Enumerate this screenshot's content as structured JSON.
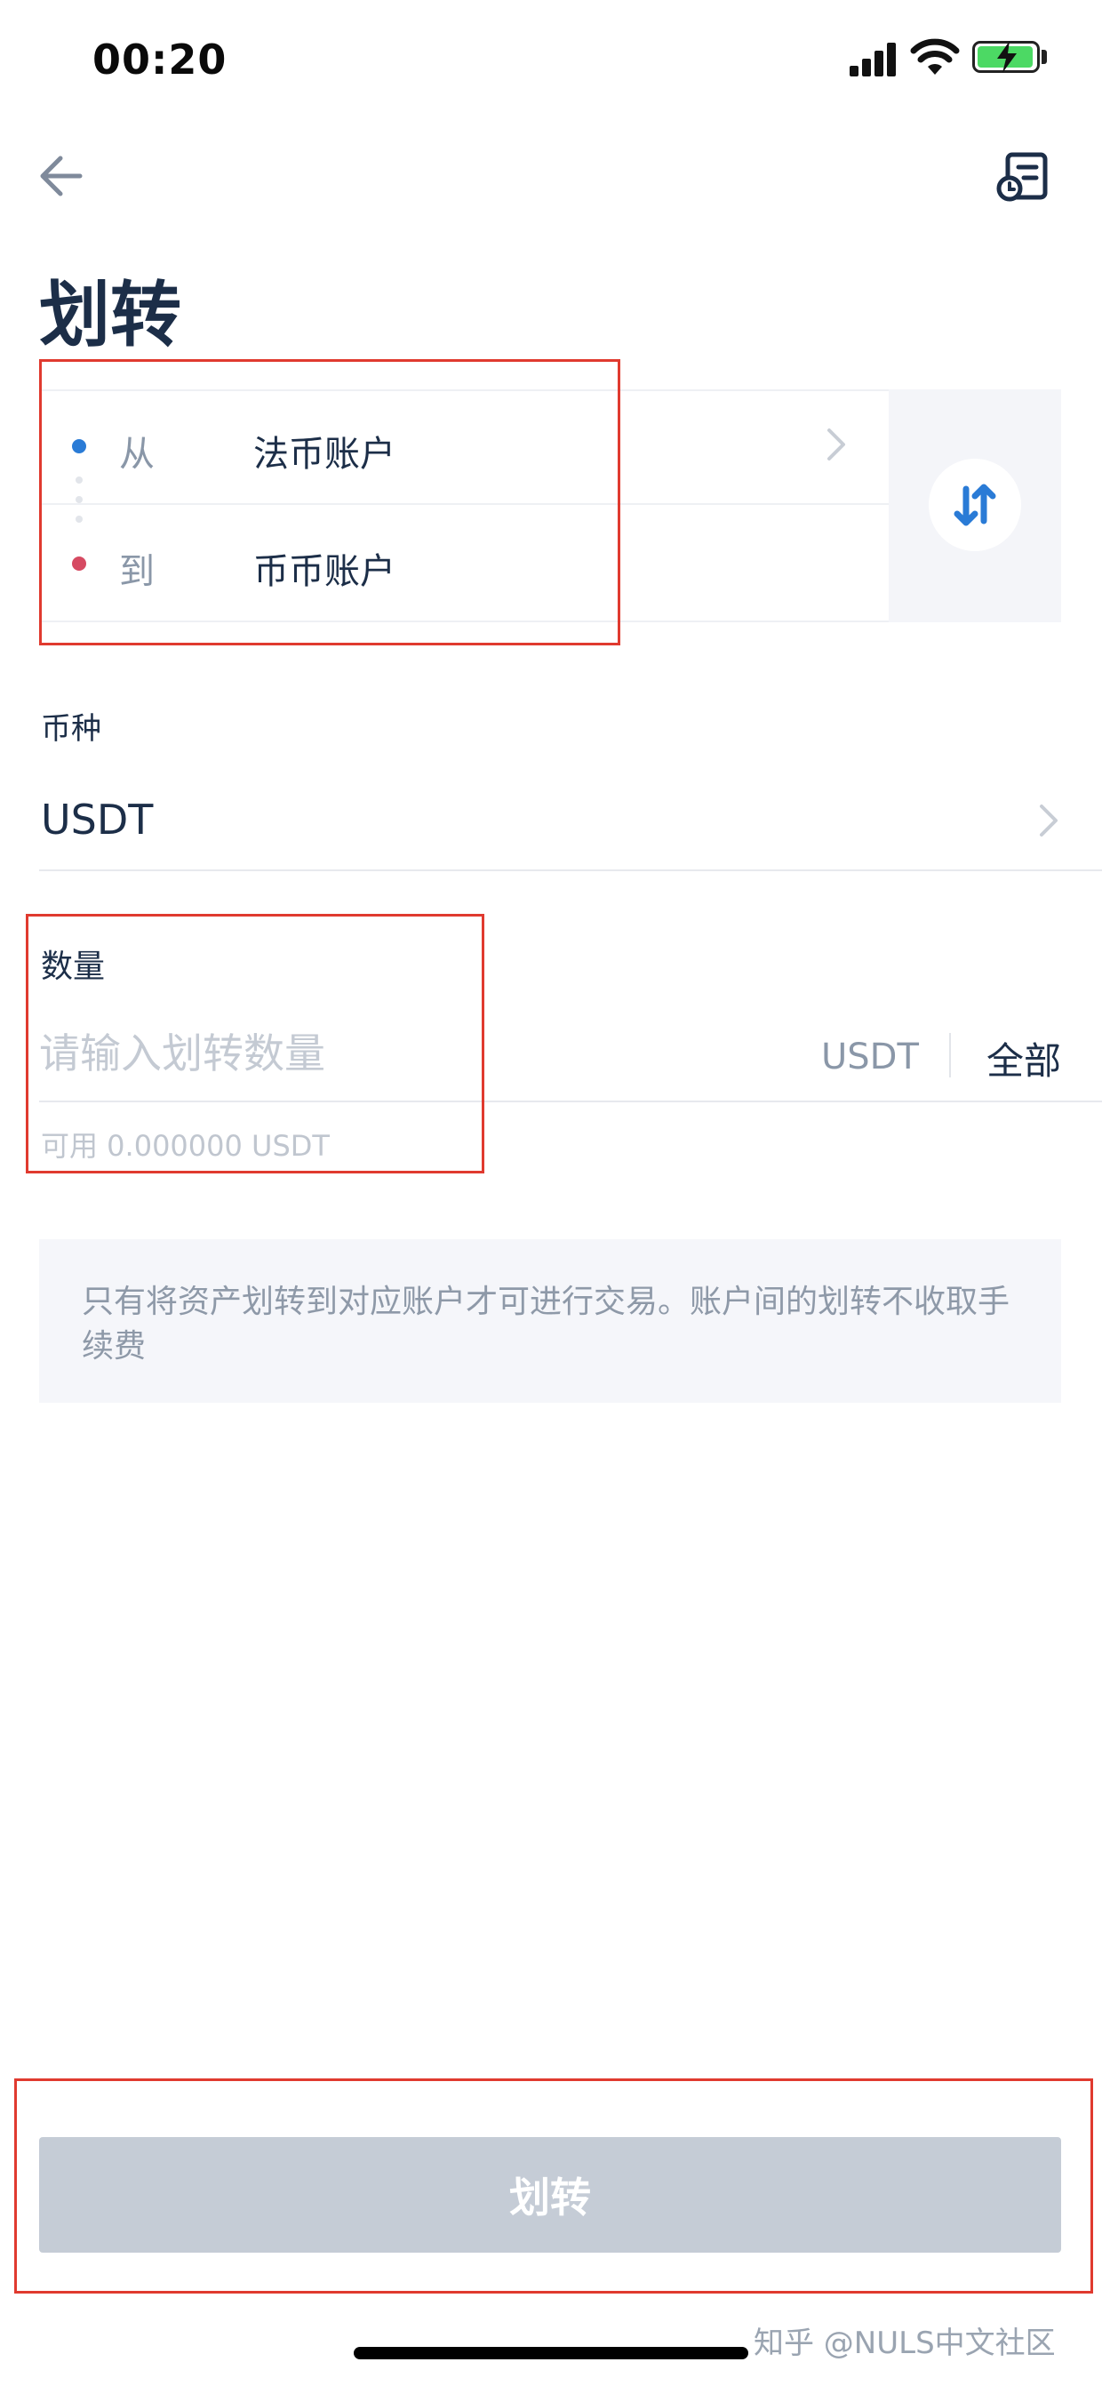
{
  "status_bar": {
    "time": "00:20"
  },
  "header": {
    "title": "划转"
  },
  "transfer": {
    "from_label": "从",
    "from_account": "法币账户",
    "to_label": "到",
    "to_account": "币币账户",
    "from_dot_color": "#2a7bd6",
    "to_dot_color": "#d64a62"
  },
  "currency": {
    "label": "币种",
    "value": "USDT"
  },
  "amount": {
    "label": "数量",
    "placeholder": "请输入划转数量",
    "unit": "USDT",
    "all_label": "全部",
    "available": "可用 0.000000 USDT"
  },
  "notice": {
    "text": "只有将资产划转到对应账户才可进行交易。账户间的划转不收取手续费"
  },
  "submit": {
    "label": "划转"
  },
  "watermark": "知乎 @NULS中文社区",
  "colors": {
    "accent": "#2a7bd6",
    "annotation_red": "#e03a2f",
    "disabled_button": "#c5ccd6"
  }
}
